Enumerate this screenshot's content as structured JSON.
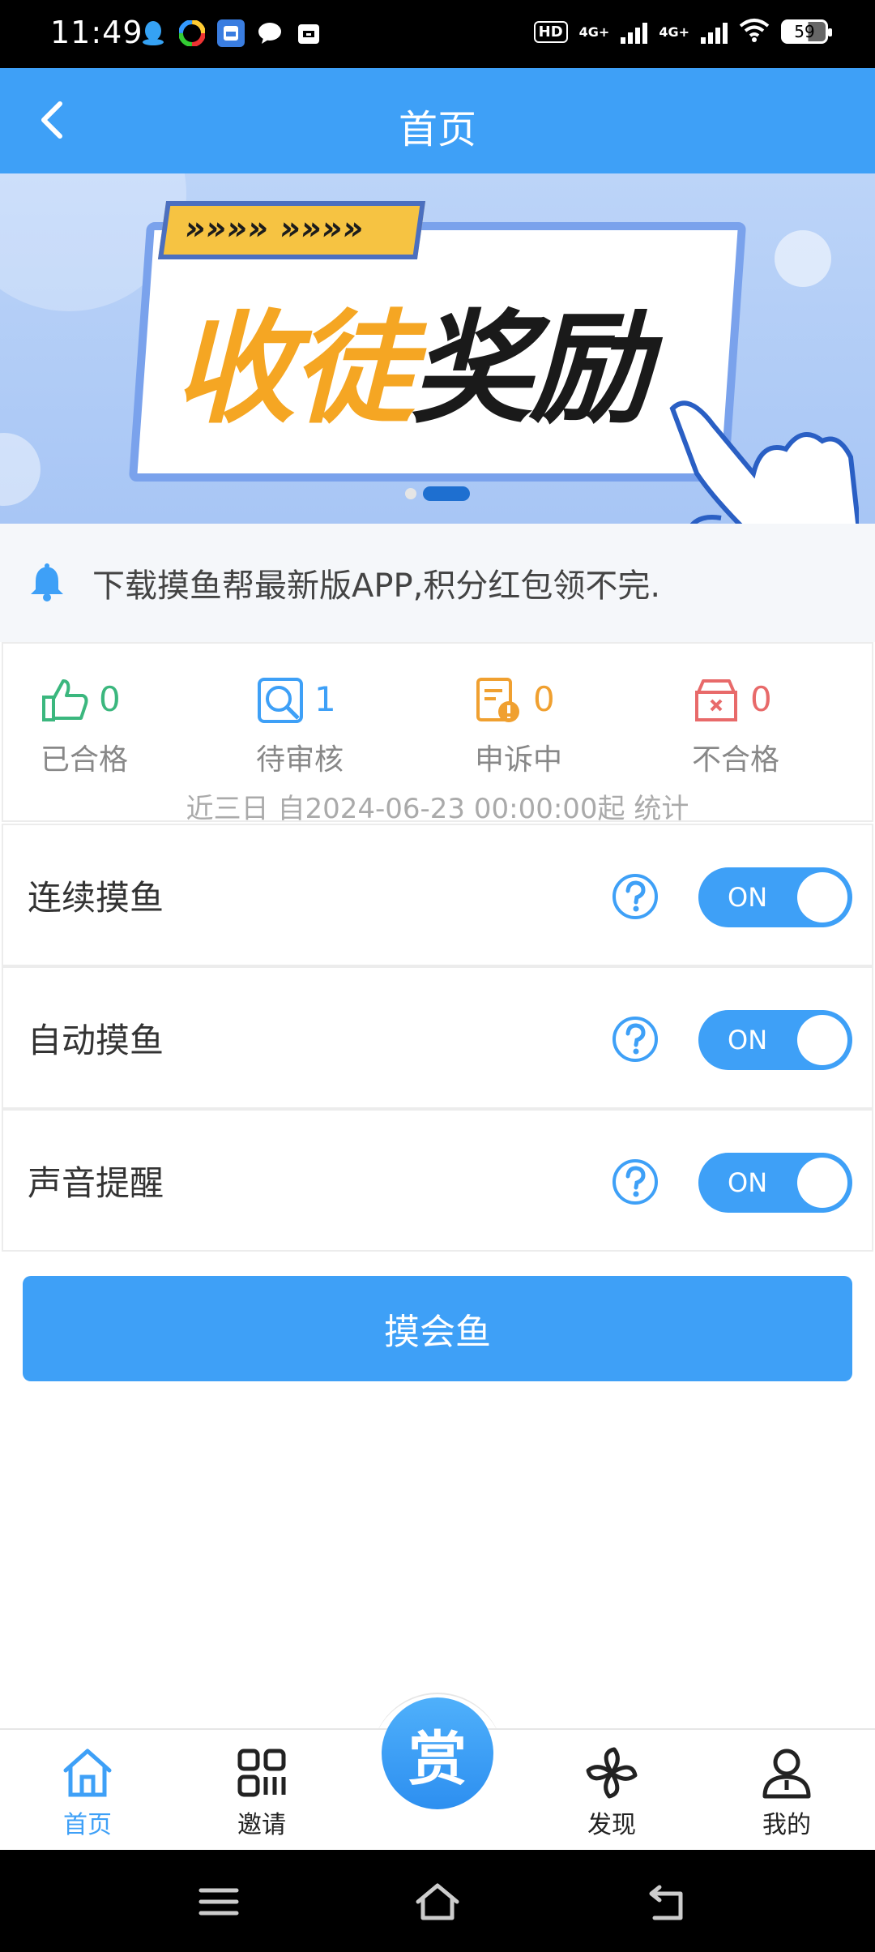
{
  "status_bar": {
    "time": "11:49",
    "hd_label": "HD",
    "network1": "4G+",
    "network2": "4G+",
    "battery": "59"
  },
  "header": {
    "title": "首页"
  },
  "banner": {
    "ribbon_text": "»»»» »»»»",
    "headline_part1": "收徒",
    "headline_part2": "奖励",
    "slide_count": 2,
    "active_slide": 2
  },
  "notice": {
    "text": "下载摸鱼帮最新版APP,积分红包领不完."
  },
  "stats": {
    "items": [
      {
        "label": "已合格",
        "value": "0",
        "color": "#3bb77e",
        "icon": "thumbs-up-icon"
      },
      {
        "label": "待审核",
        "value": "1",
        "color": "#3ea0f7",
        "icon": "search-review-icon"
      },
      {
        "label": "申诉中",
        "value": "0",
        "color": "#f0a030",
        "icon": "appeal-doc-icon"
      },
      {
        "label": "不合格",
        "value": "0",
        "color": "#e86a6a",
        "icon": "rejected-box-icon"
      }
    ],
    "footer": "近三日 自2024-06-23 00:00:00起 统计"
  },
  "settings": [
    {
      "label": "连续摸鱼",
      "toggle": "ON"
    },
    {
      "label": "自动摸鱼",
      "toggle": "ON"
    },
    {
      "label": "声音提醒",
      "toggle": "ON"
    }
  ],
  "main_button": {
    "label": "摸会鱼"
  },
  "tabbar": {
    "items": [
      {
        "label": "首页",
        "icon": "home-icon",
        "active": true
      },
      {
        "label": "邀请",
        "icon": "invite-grid-icon",
        "active": false
      },
      {
        "label": "发现",
        "icon": "discover-pinwheel-icon",
        "active": false
      },
      {
        "label": "我的",
        "icon": "profile-icon",
        "active": false
      }
    ],
    "center_label": "赏"
  },
  "colors": {
    "primary": "#3ea0f7",
    "banner_yellow": "#f5a623"
  }
}
